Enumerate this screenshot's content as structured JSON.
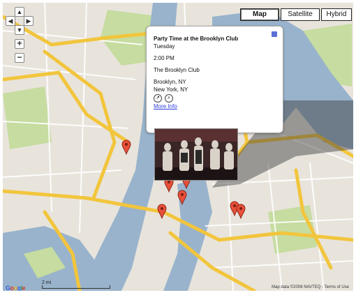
{
  "map_types": [
    {
      "label": "Map",
      "active": true
    },
    {
      "label": "Satellite",
      "active": false
    },
    {
      "label": "Hybrid",
      "active": false
    }
  ],
  "nav": {
    "up": "▲",
    "left": "◀",
    "right": "▶",
    "down": "▼",
    "zoom_in": "+",
    "zoom_out": "−"
  },
  "info_window": {
    "title": "Party Time at the Brooklyn Club",
    "lines": [
      "Tuesday",
      "2:00 PM",
      "The Brooklyn Club",
      "Brooklyn, NY",
      "New York, NY"
    ],
    "link": "More Info"
  },
  "photo": {
    "alt": "band photo"
  },
  "scale": {
    "label": "2 mi"
  },
  "logo": {
    "letters": [
      "G",
      "o",
      "o",
      "g",
      "l",
      "e"
    ]
  },
  "attribution": "Map data ©2008 NAVTEQ - Terms of Use",
  "colors": {
    "road_major": "#f2c53d",
    "road_minor": "#ffffff",
    "water": "#99b3cc",
    "park": "#c6dca0",
    "land": "#e8e4dc",
    "marker": "#e8503a"
  }
}
